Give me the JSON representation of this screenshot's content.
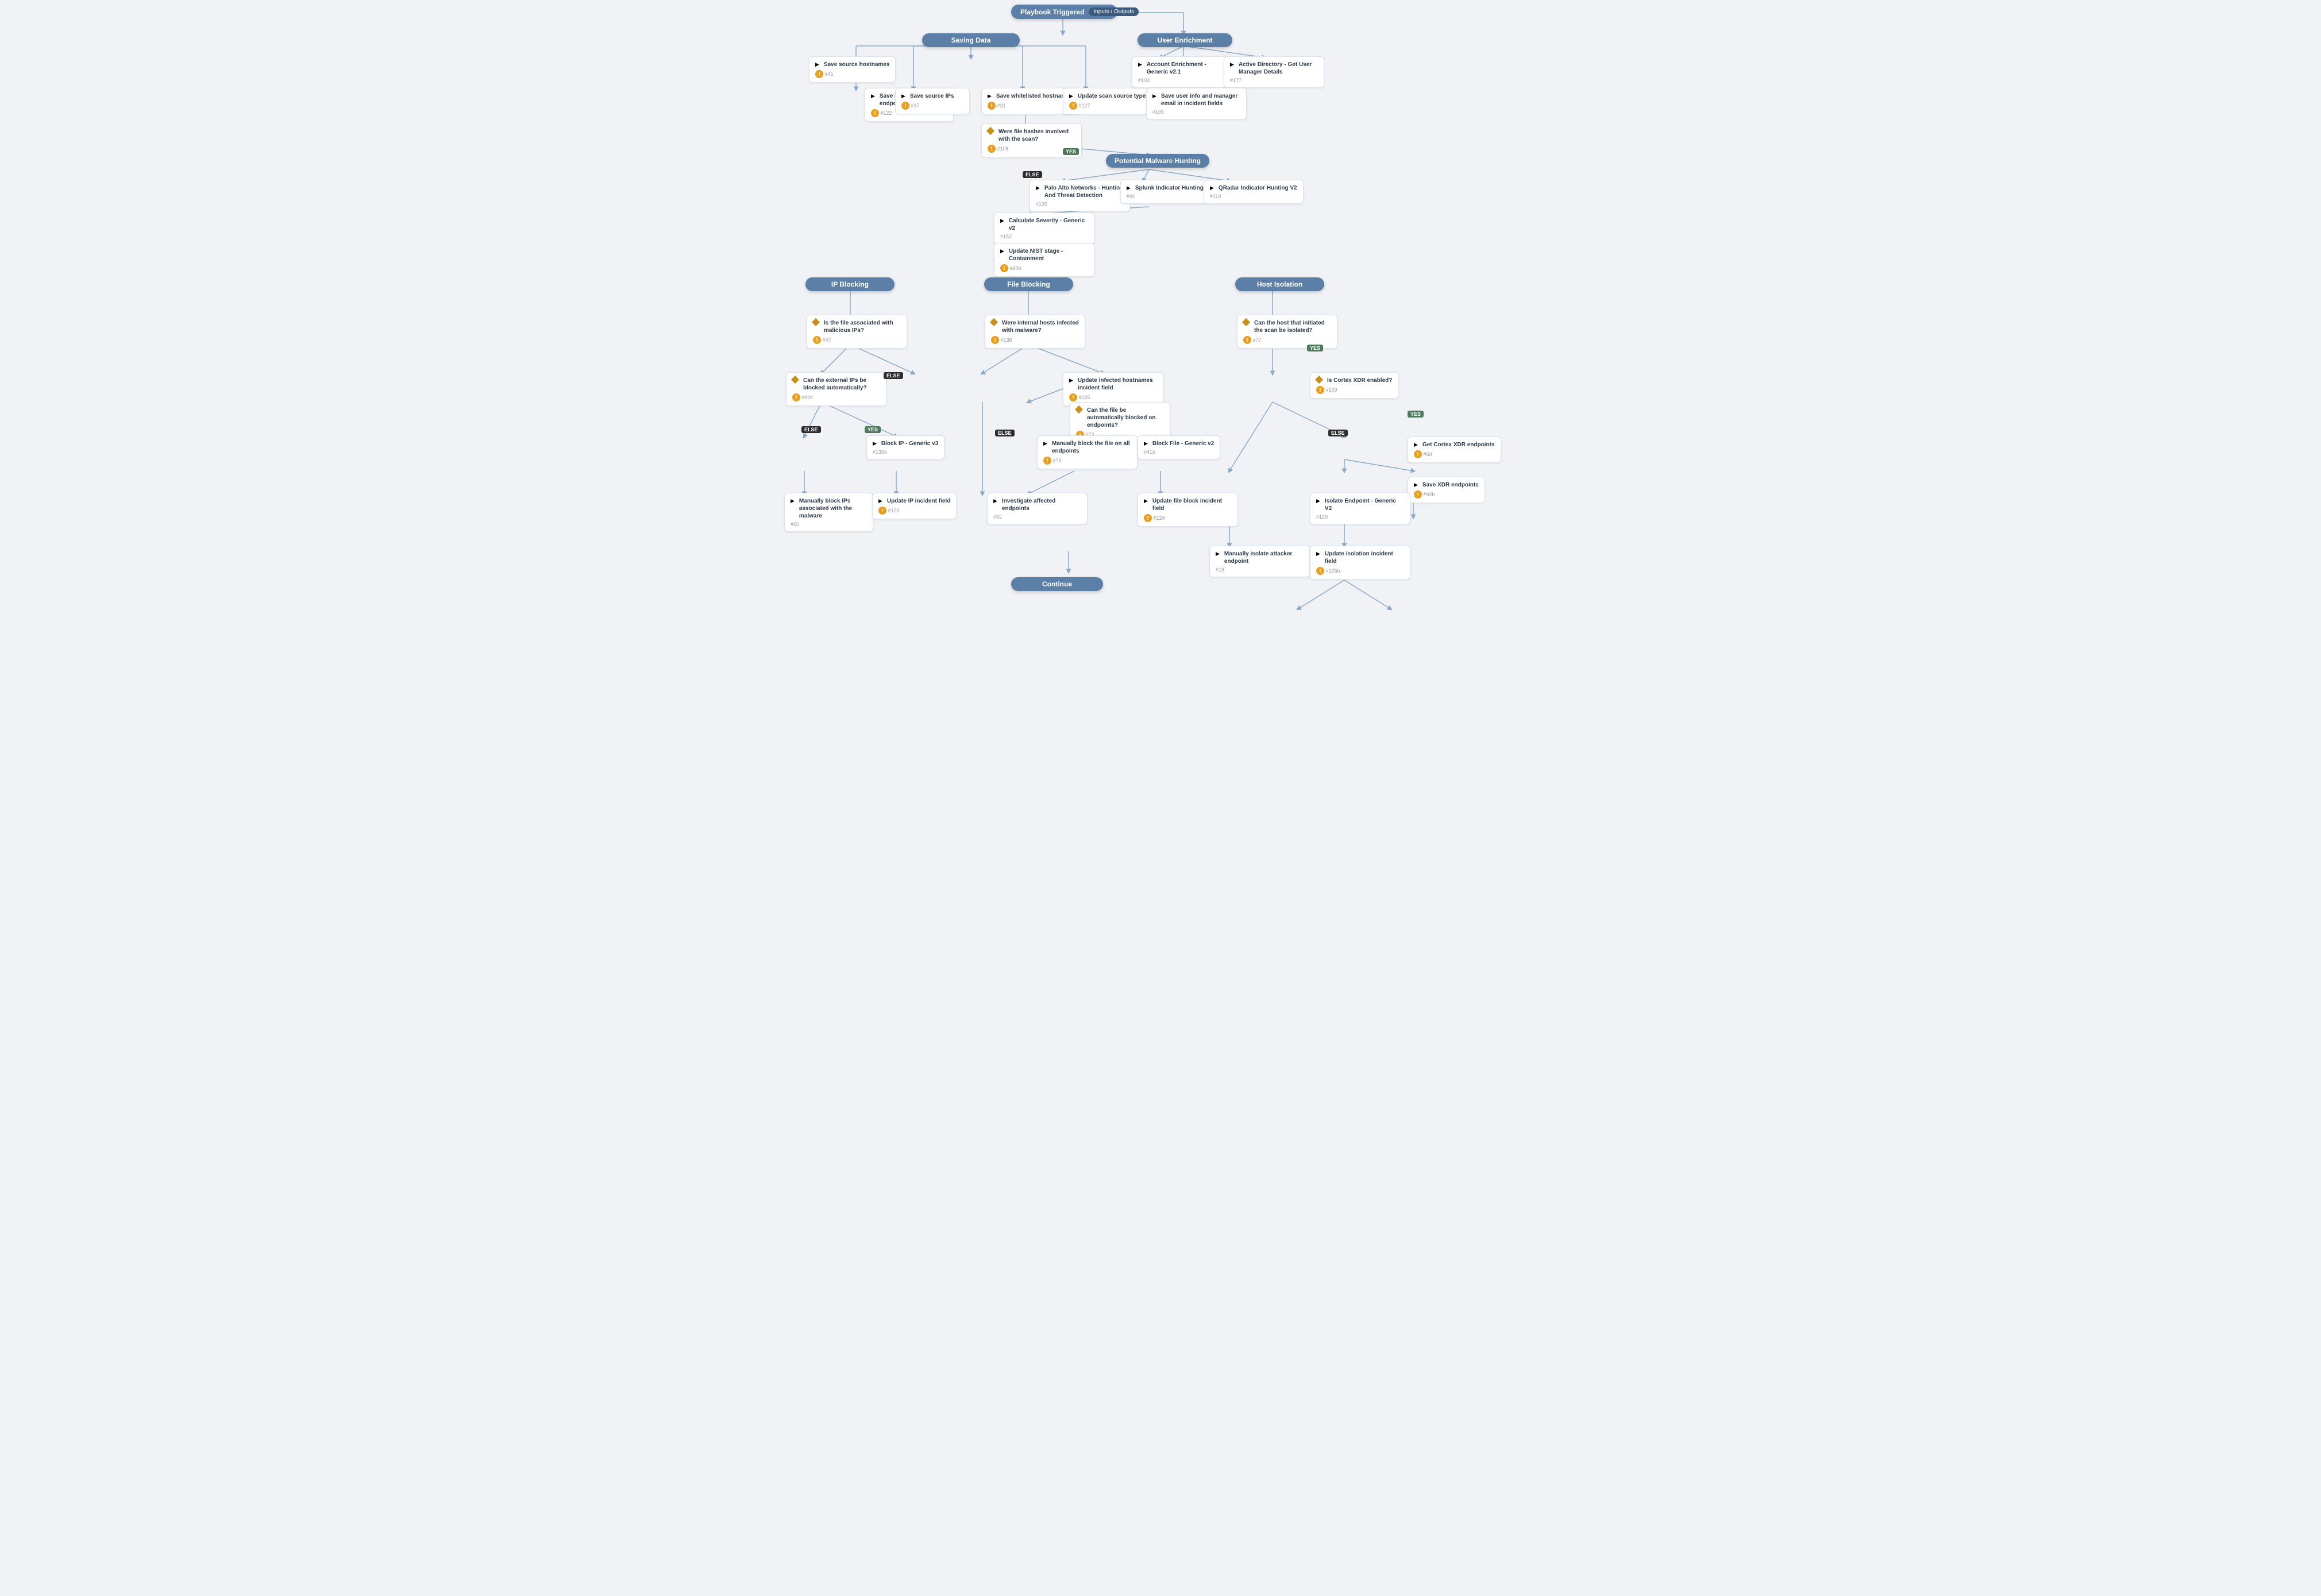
{
  "title": "Playbook Triggered",
  "io_badge": "Inputs / Outputs",
  "sections": {
    "saving_data": "Saving Data",
    "user_enrichment": "User Enrichment",
    "potential_malware": "Potential Malware Hunting",
    "ip_blocking": "IP Blocking",
    "file_blocking": "File Blocking",
    "host_isolation": "Host Isolation",
    "continue": "Continue"
  },
  "nodes": {
    "save_hostnames": {
      "title": "Save source hostnames",
      "id": "#41"
    },
    "save_endpoint": {
      "title": "Save hostnames as endpoint objects",
      "id": "#122"
    },
    "save_source_ips": {
      "title": "Save source IPs",
      "id": "#37"
    },
    "save_whitelisted": {
      "title": "Save whitelisted hostnames",
      "id": "#31"
    },
    "update_scan_source": {
      "title": "Update scan source type",
      "id": "#127"
    },
    "save_user_info": {
      "title": "Save user info and manager email in incident fields",
      "id": "#105"
    },
    "account_enrichment": {
      "title": "Account Enrichment - Generic v2.1",
      "id": "#103"
    },
    "ad_get_user": {
      "title": "Active Directory - Get User Manager Details",
      "id": "#177"
    },
    "were_file_hashes": {
      "title": "Were file hashes involved with the scan?",
      "id": "#108",
      "decision": true
    },
    "palo_alto": {
      "title": "Palo Alto Networks - Hunting And Threat Detection",
      "id": "#130"
    },
    "splunk_indicator": {
      "title": "Splunk Indicator Hunting",
      "id": "#90"
    },
    "qradar": {
      "title": "QRadar Indicator Hunting V2",
      "id": "#110"
    },
    "calc_severity": {
      "title": "Calculate Severity - Generic v2",
      "id": "#152"
    },
    "update_nist": {
      "title": "Update NIST stage - Containment",
      "id": "#90b"
    },
    "is_file_malicious": {
      "title": "Is the file associated with malicious IPs?",
      "id": "#47",
      "decision": true
    },
    "can_external_ips": {
      "title": "Can the external IPs be blocked automatically?",
      "id": "#90c",
      "decision": true
    },
    "block_ip_generic": {
      "title": "Block IP - Generic v3",
      "id": "#130b"
    },
    "manually_block_ips": {
      "title": "Manually block IPs associated with the malware",
      "id": "#50"
    },
    "update_ip_incident": {
      "title": "Update IP incident field",
      "id": "#120"
    },
    "were_internal_hosts": {
      "title": "Were internal hosts infected with malware?",
      "id": "#136",
      "decision": true
    },
    "update_infected": {
      "title": "Update infected hostnames incident field",
      "id": "#125"
    },
    "can_file_blocked": {
      "title": "Can the file be automatically blocked on endpoints?",
      "id": "#72",
      "decision": true
    },
    "manually_block_file": {
      "title": "Manually block the file on all endpoints",
      "id": "#75"
    },
    "block_file_generic": {
      "title": "Block File - Generic v2",
      "id": "#41b"
    },
    "investigate_endpoints": {
      "title": "Investigate affected endpoints",
      "id": "#92"
    },
    "update_file_block": {
      "title": "Update file block incident field",
      "id": "#124"
    },
    "can_host_isolated": {
      "title": "Can the host that initiated the scan be isolated?",
      "id": "#77",
      "decision": true
    },
    "is_cortex_xdr": {
      "title": "Is Cortex XDR enabled?",
      "id": "#109",
      "decision": true
    },
    "get_cortex_endpoints": {
      "title": "Get Cortex XDR endpoints",
      "id": "#60"
    },
    "save_xdr_endpoints": {
      "title": "Save XDR endpoints",
      "id": "#92b"
    },
    "isolate_endpoint": {
      "title": "Isolate Endpoint - Generic V2",
      "id": "#129"
    },
    "manually_isolate": {
      "title": "Manually isolate attacker endpoint",
      "id": "#18"
    },
    "update_isolation": {
      "title": "Update isolation incident field",
      "id": "#125b"
    }
  }
}
